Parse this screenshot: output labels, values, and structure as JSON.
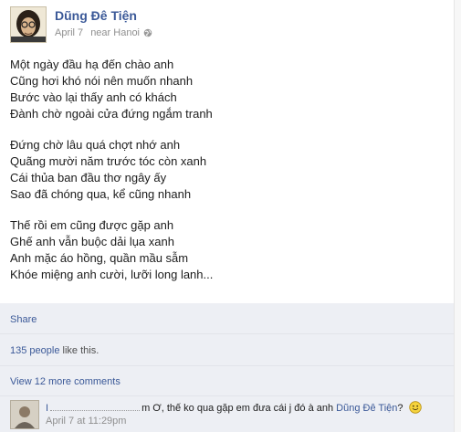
{
  "post": {
    "author": "Dũng Đê Tiện",
    "date": "April 7",
    "location": "near Hanoi",
    "audience_icon": "globe-icon"
  },
  "poem": {
    "stanzas": [
      [
        "Một ngày đầu hạ đến chào anh",
        "Cũng hơi khó nói nên muốn nhanh",
        "Bước vào lại thấy anh có khách",
        "Đành chờ ngoài cửa đứng ngắm tranh"
      ],
      [
        "Đứng chờ lâu quá chợt nhớ anh",
        "Quãng mười năm trước tóc còn xanh",
        "Cái thủa ban đầu thơ ngây ấy",
        "Sao đã chóng qua, kể cũng nhanh"
      ],
      [
        "Thế rồi em cũng được gặp anh",
        "Ghế anh vẫn buộc dải lụa xanh",
        "Anh mặc áo hồng, quần mầu sẫm",
        "Khóe miệng anh cười, lưỡi long lanh..."
      ]
    ]
  },
  "actions": {
    "share": "Share"
  },
  "likes": {
    "count": "135 people",
    "suffix": " like this."
  },
  "comments": {
    "view_more": "View 12 more comments",
    "items": [
      {
        "name_prefix": "I",
        "text": "m Ơ, thế ko qua gặp em đưa cái j đó à anh ",
        "mention": "Dũng Đê Tiện",
        "after_mention": "?",
        "emoticon": "smile-icon",
        "time": "April 7 at 11:29pm"
      }
    ]
  },
  "colors": {
    "link": "#3b5998",
    "panel": "#edeff4",
    "meta": "#8f8f8f"
  }
}
